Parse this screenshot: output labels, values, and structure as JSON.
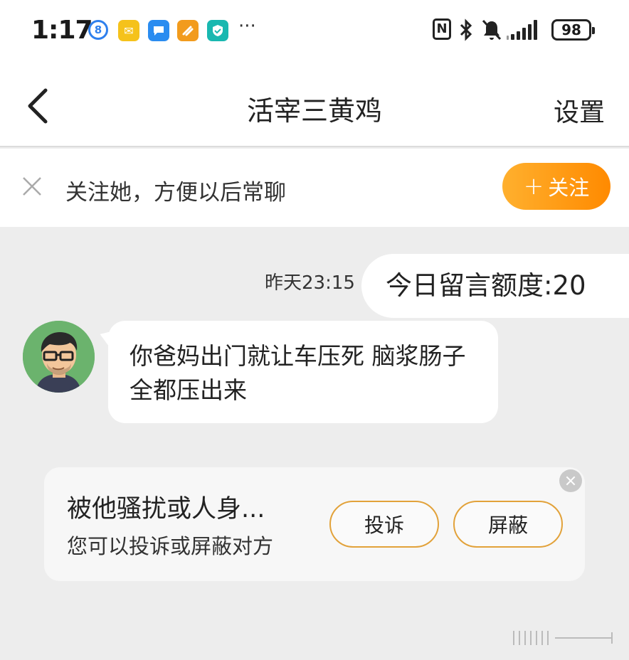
{
  "status_bar": {
    "time": "1:17",
    "battery": "98",
    "overflow": "···",
    "notifications": [
      {
        "icon": "8"
      },
      {
        "icon": "mail-icon"
      },
      {
        "icon": "chat-icon"
      },
      {
        "icon": "news-icon"
      },
      {
        "icon": "shield-icon"
      }
    ]
  },
  "header": {
    "title": "活宰三黄鸡",
    "settings_label": "设置"
  },
  "follow_bar": {
    "prompt": "关注她，方便以后常聊",
    "button_label": "关注",
    "accent_color": "#ff9500"
  },
  "chat": {
    "timestamp": "昨天23:15",
    "quota_message": "今日留言额度:20",
    "incoming_message": "你爸妈出门就让车压死 脑浆肠子全都压出来"
  },
  "warning_card": {
    "title": "被他骚扰或人身...",
    "subtitle": "您可以投诉或屏蔽对方",
    "report_label": "投诉",
    "block_label": "屏蔽",
    "border_color": "#e2a23a"
  }
}
